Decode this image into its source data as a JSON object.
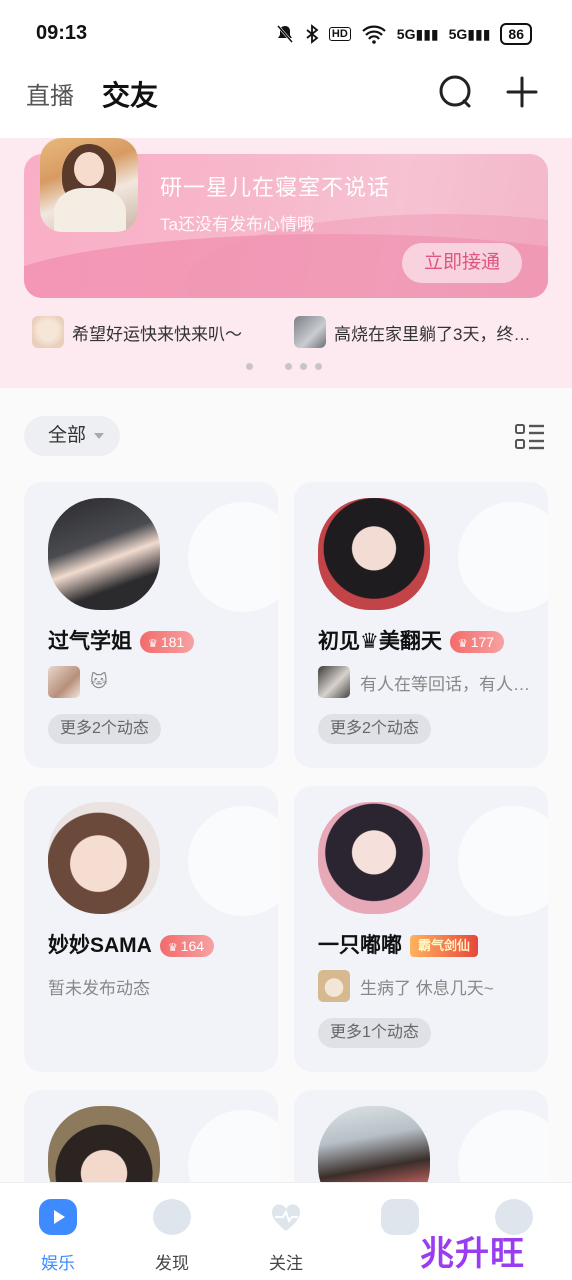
{
  "status_bar": {
    "time": "09:13",
    "battery": "86",
    "net1": "5G",
    "net2": "5G"
  },
  "top_nav": {
    "tab_live": "直播",
    "tab_friends": "交友"
  },
  "banner": {
    "title": "研一星儿在寝室不说话",
    "subtitle": "Ta还没有发布心情哦",
    "button": "立即接通"
  },
  "ticker": [
    {
      "text": "希望好运快来快来叭～"
    },
    {
      "text": "高烧在家里躺了3天，终…"
    }
  ],
  "filter": {
    "label": "全部"
  },
  "cards": [
    {
      "nickname": "过气学姐",
      "level": "181",
      "status": "🐱",
      "more": "更多2个动态"
    },
    {
      "nickname": "初见♛美翻天",
      "level": "177",
      "status": "有人在等回话，有人…",
      "more": "更多2个动态"
    },
    {
      "nickname": "妙妙SAMA",
      "level": "164",
      "status": "暂未发布动态",
      "more": ""
    },
    {
      "nickname": "一只嘟嘟",
      "title_badge": "霸气剑仙",
      "status": "生病了 休息几天~",
      "more": "更多1个动态"
    },
    {
      "nickname": "",
      "status": "",
      "more": ""
    },
    {
      "nickname": "",
      "status": "",
      "more": ""
    }
  ],
  "bottom_nav": [
    {
      "label": "娱乐"
    },
    {
      "label": "发现"
    },
    {
      "label": "关注"
    },
    {
      "label": ""
    },
    {
      "label": ""
    }
  ],
  "watermark": "兆升旺",
  "colors": {
    "accent": "#3e8bff",
    "banner_pink": "#f7b8cb",
    "badge_red": "#f36b6b"
  }
}
